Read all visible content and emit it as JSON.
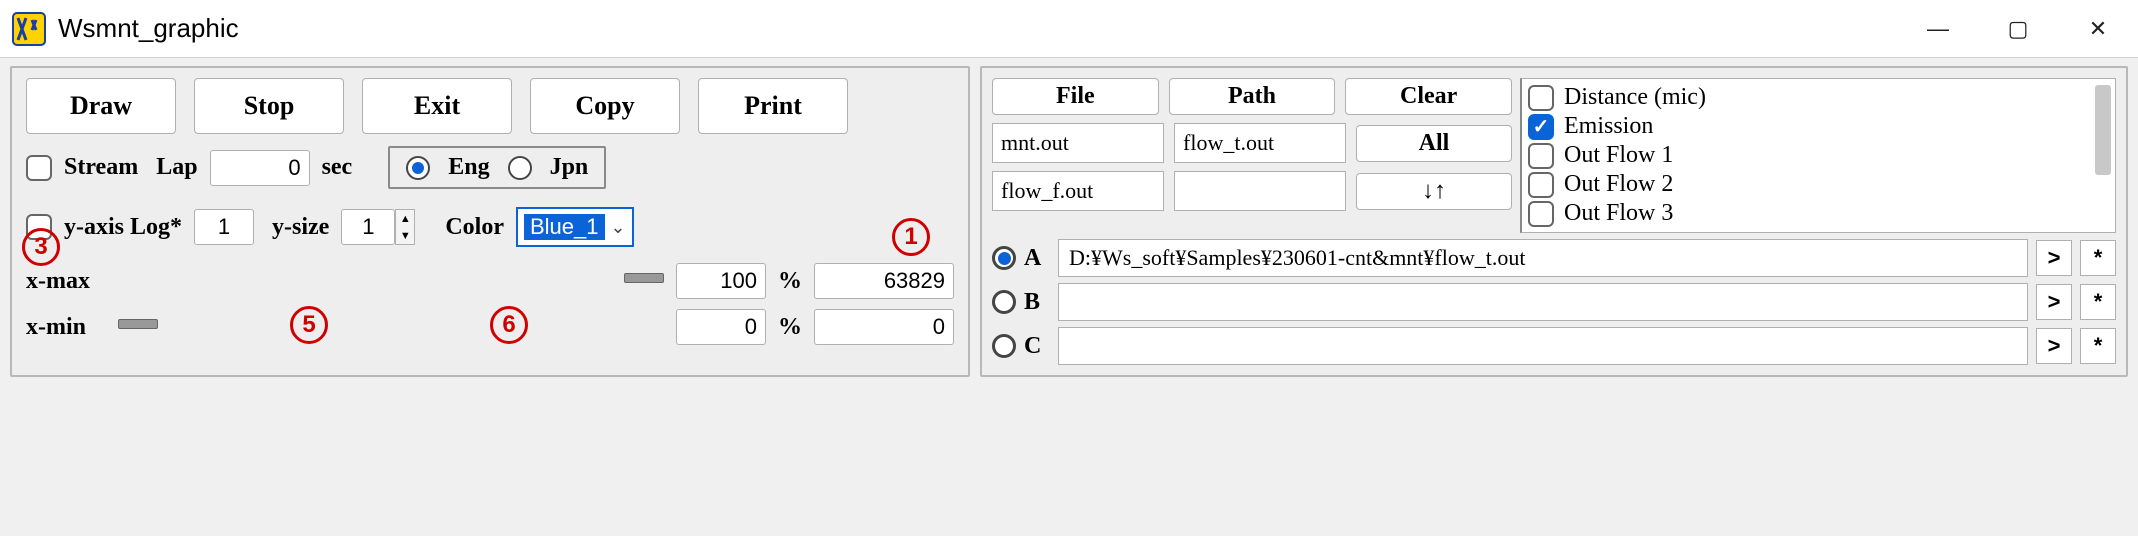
{
  "window": {
    "title": "Wsmnt_graphic",
    "min_icon": "—",
    "max_icon": "▢",
    "close_icon": "✕"
  },
  "toolbar": {
    "draw": "Draw",
    "stop": "Stop",
    "exit": "Exit",
    "copy": "Copy",
    "print": "Print"
  },
  "left": {
    "stream_label": "Stream",
    "stream_checked": false,
    "lap_label": "Lap",
    "lap_value": "0",
    "lap_unit": "sec",
    "lang_eng": "Eng",
    "lang_jpn": "Jpn",
    "lang_selected": "Eng",
    "yaxis_log_label": "y-axis Log*",
    "yaxis_log_checked": false,
    "yaxis_log_value": "1",
    "ysize_label": "y-size",
    "ysize_value": "1",
    "color_label": "Color",
    "color_value": "Blue_1",
    "xmax_label": "x-max",
    "xmax_pct": "100",
    "xmax_val": "63829",
    "xmin_label": "x-min",
    "xmin_pct": "0",
    "xmin_val": "0",
    "pct_symbol": "%"
  },
  "annotations": {
    "n1": "1",
    "n3": "3",
    "n5": "5",
    "n6": "6"
  },
  "right": {
    "file_btn": "File",
    "path_btn": "Path",
    "clear_btn": "Clear",
    "all_btn": "All",
    "swap_icon": "↓↑",
    "cells": {
      "mnt_out": "mnt.out",
      "flow_t_out": "flow_t.out",
      "flow_f_out": "flow_f.out",
      "blank": ""
    },
    "checks": [
      {
        "label": "Distance (mic)",
        "checked": false
      },
      {
        "label": "Emission",
        "checked": true
      },
      {
        "label": "Out Flow 1",
        "checked": false
      },
      {
        "label": "Out Flow 2",
        "checked": false
      },
      {
        "label": "Out Flow 3",
        "checked": false
      }
    ],
    "files": {
      "a_label": "A",
      "b_label": "B",
      "c_label": "C",
      "selected": "A",
      "a_path": "D:¥Ws_soft¥Samples¥230601-cnt&mnt¥flow_t.out",
      "b_path": "",
      "c_path": "",
      "go": ">",
      "star": "*"
    }
  }
}
